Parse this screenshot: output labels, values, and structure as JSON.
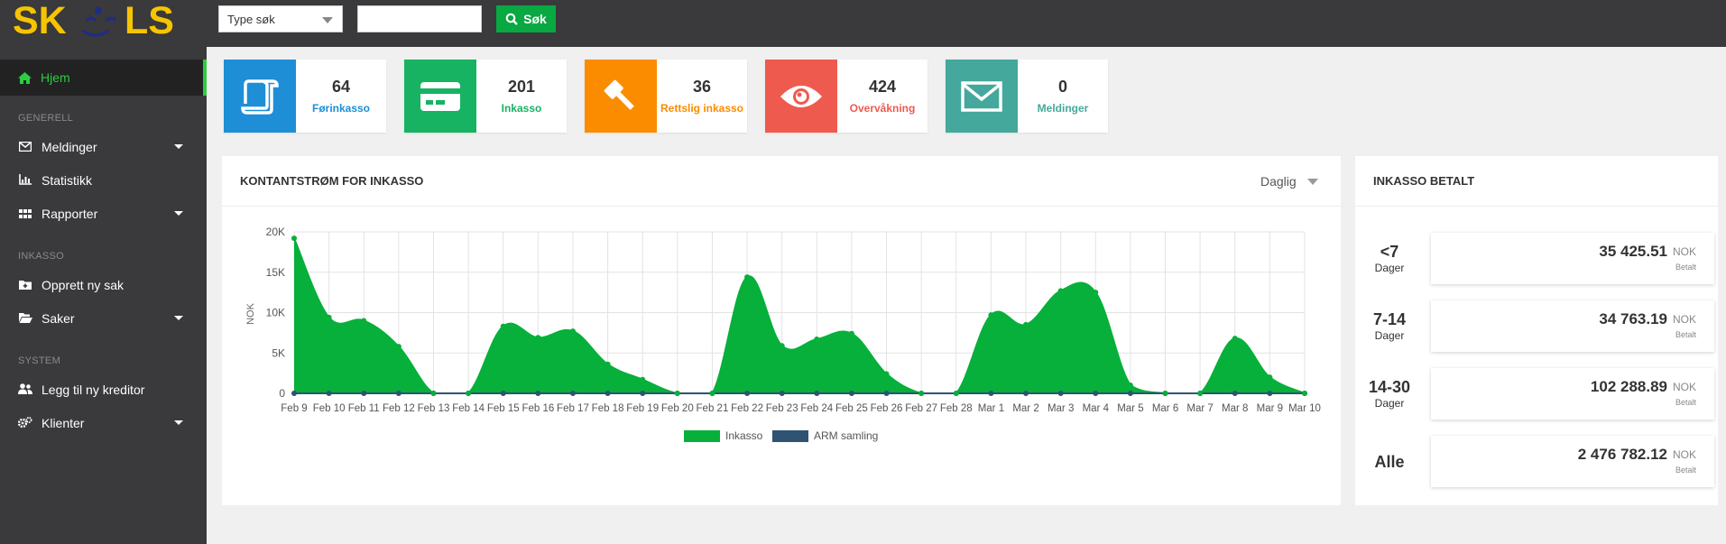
{
  "brand": {
    "logo_text": "SKILS"
  },
  "search": {
    "type_placeholder": "Type søk",
    "button_label": "Søk",
    "input_value": ""
  },
  "sidebar": {
    "home": "Hjem",
    "sections": [
      {
        "header": "GENERELL",
        "items": [
          {
            "label": "Meldinger",
            "icon": "envelope-icon"
          },
          {
            "label": "Statistikk",
            "icon": "bar-chart-icon"
          },
          {
            "label": "Rapporter",
            "icon": "grid-icon"
          }
        ]
      },
      {
        "header": "INKASSO",
        "items": [
          {
            "label": "Opprett ny sak",
            "icon": "folder-plus-icon"
          },
          {
            "label": "Saker",
            "icon": "folder-open-icon"
          }
        ]
      },
      {
        "header": "SYSTEM",
        "items": [
          {
            "label": "Legg til ny kreditor",
            "icon": "users-icon"
          },
          {
            "label": "Klienter",
            "icon": "gears-icon"
          }
        ]
      }
    ]
  },
  "stats": [
    {
      "value": "64",
      "label": "Førinkasso",
      "color": "#1e8ed6",
      "icon": "scroll-icon"
    },
    {
      "value": "201",
      "label": "Inkasso",
      "color": "#17b262",
      "icon": "credit-card-icon"
    },
    {
      "value": "36",
      "label": "Rettslig inkasso",
      "color": "#fb8c00",
      "icon": "gavel-icon"
    },
    {
      "value": "424",
      "label": "Overvåkning",
      "color": "#ef5a4e",
      "icon": "eye-icon"
    },
    {
      "value": "0",
      "label": "Meldinger",
      "color": "#45a89c",
      "icon": "envelope-icon"
    }
  ],
  "cashflow": {
    "title": "KONTANTSTRØM FOR INKASSO",
    "period": "Daglig"
  },
  "chart_data": {
    "type": "area",
    "ylabel": "NOK",
    "xlabel": "",
    "ylim": [
      0,
      20000
    ],
    "yticks": [
      "0",
      "5K",
      "10K",
      "15K",
      "20K"
    ],
    "categories": [
      "Feb 9",
      "Feb 10",
      "Feb 11",
      "Feb 12",
      "Feb 13",
      "Feb 14",
      "Feb 15",
      "Feb 16",
      "Feb 17",
      "Feb 18",
      "Feb 19",
      "Feb 20",
      "Feb 21",
      "Feb 22",
      "Feb 23",
      "Feb 24",
      "Feb 25",
      "Feb 26",
      "Feb 27",
      "Feb 28",
      "Mar 1",
      "Mar 2",
      "Mar 3",
      "Mar 4",
      "Mar 5",
      "Mar 6",
      "Mar 7",
      "Mar 8",
      "Mar 9",
      "Mar 10"
    ],
    "series": [
      {
        "name": "Inkasso",
        "color": "#06b03a",
        "values": [
          19200,
          9400,
          9000,
          5800,
          0,
          0,
          8300,
          6900,
          7700,
          3600,
          1700,
          0,
          0,
          14400,
          5900,
          6700,
          7400,
          2400,
          0,
          0,
          9700,
          8500,
          12700,
          12500,
          1000,
          0,
          0,
          6800,
          2000,
          0
        ]
      },
      {
        "name": "ARM samling",
        "color": "#2e5373",
        "values": [
          0,
          0,
          0,
          0,
          0,
          0,
          0,
          0,
          0,
          0,
          0,
          0,
          0,
          0,
          0,
          0,
          0,
          0,
          0,
          0,
          0,
          0,
          0,
          0,
          0,
          0,
          0,
          0,
          0,
          0
        ]
      }
    ],
    "legend": "bottom-center",
    "grid": true
  },
  "paid": {
    "title": "INKASSO BETALT",
    "rows": [
      {
        "big": "<7",
        "small": "Dager",
        "amount": "35 425.51",
        "currency": "NOK",
        "sub": "Betalt"
      },
      {
        "big": "7-14",
        "small": "Dager",
        "amount": "34 763.19",
        "currency": "NOK",
        "sub": "Betalt"
      },
      {
        "big": "14-30",
        "small": "Dager",
        "amount": "102 288.89",
        "currency": "NOK",
        "sub": "Betalt"
      },
      {
        "big": "Alle",
        "small": "",
        "amount": "2 476 782.12",
        "currency": "NOK",
        "sub": "Betalt"
      }
    ]
  }
}
